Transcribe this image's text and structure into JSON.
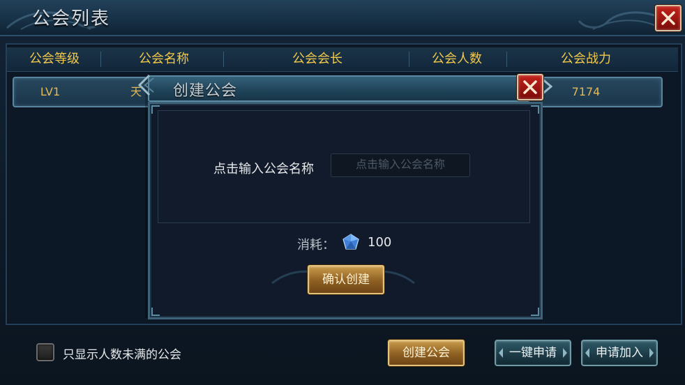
{
  "window": {
    "title": "公会列表"
  },
  "table": {
    "headers": [
      "公会等级",
      "公会名称",
      "公会会长",
      "公会人数",
      "公会战力"
    ],
    "rows": [
      {
        "level": "LV1",
        "name_partial": "天",
        "power": "7174"
      }
    ]
  },
  "footer": {
    "filter_label": "只显示人数未满的公会",
    "filter_checked": false,
    "create_button": "创建公会",
    "one_click_apply_button": "一键申请",
    "apply_join_button": "申请加入"
  },
  "modal": {
    "title": "创建公会",
    "name_label": "点击输入公会名称",
    "name_placeholder": "点击输入公会名称",
    "name_value": "",
    "cost_label": "消耗：",
    "cost_icon": "diamond-gem-icon",
    "cost_value": "100",
    "confirm_button": "确认创建"
  },
  "colors": {
    "header_gold": "#f2c94a",
    "row_gold": "#e2b955",
    "close_red": "#c2221b",
    "button_gold": "#c99b4b",
    "button_teal": "#2f5a68"
  }
}
